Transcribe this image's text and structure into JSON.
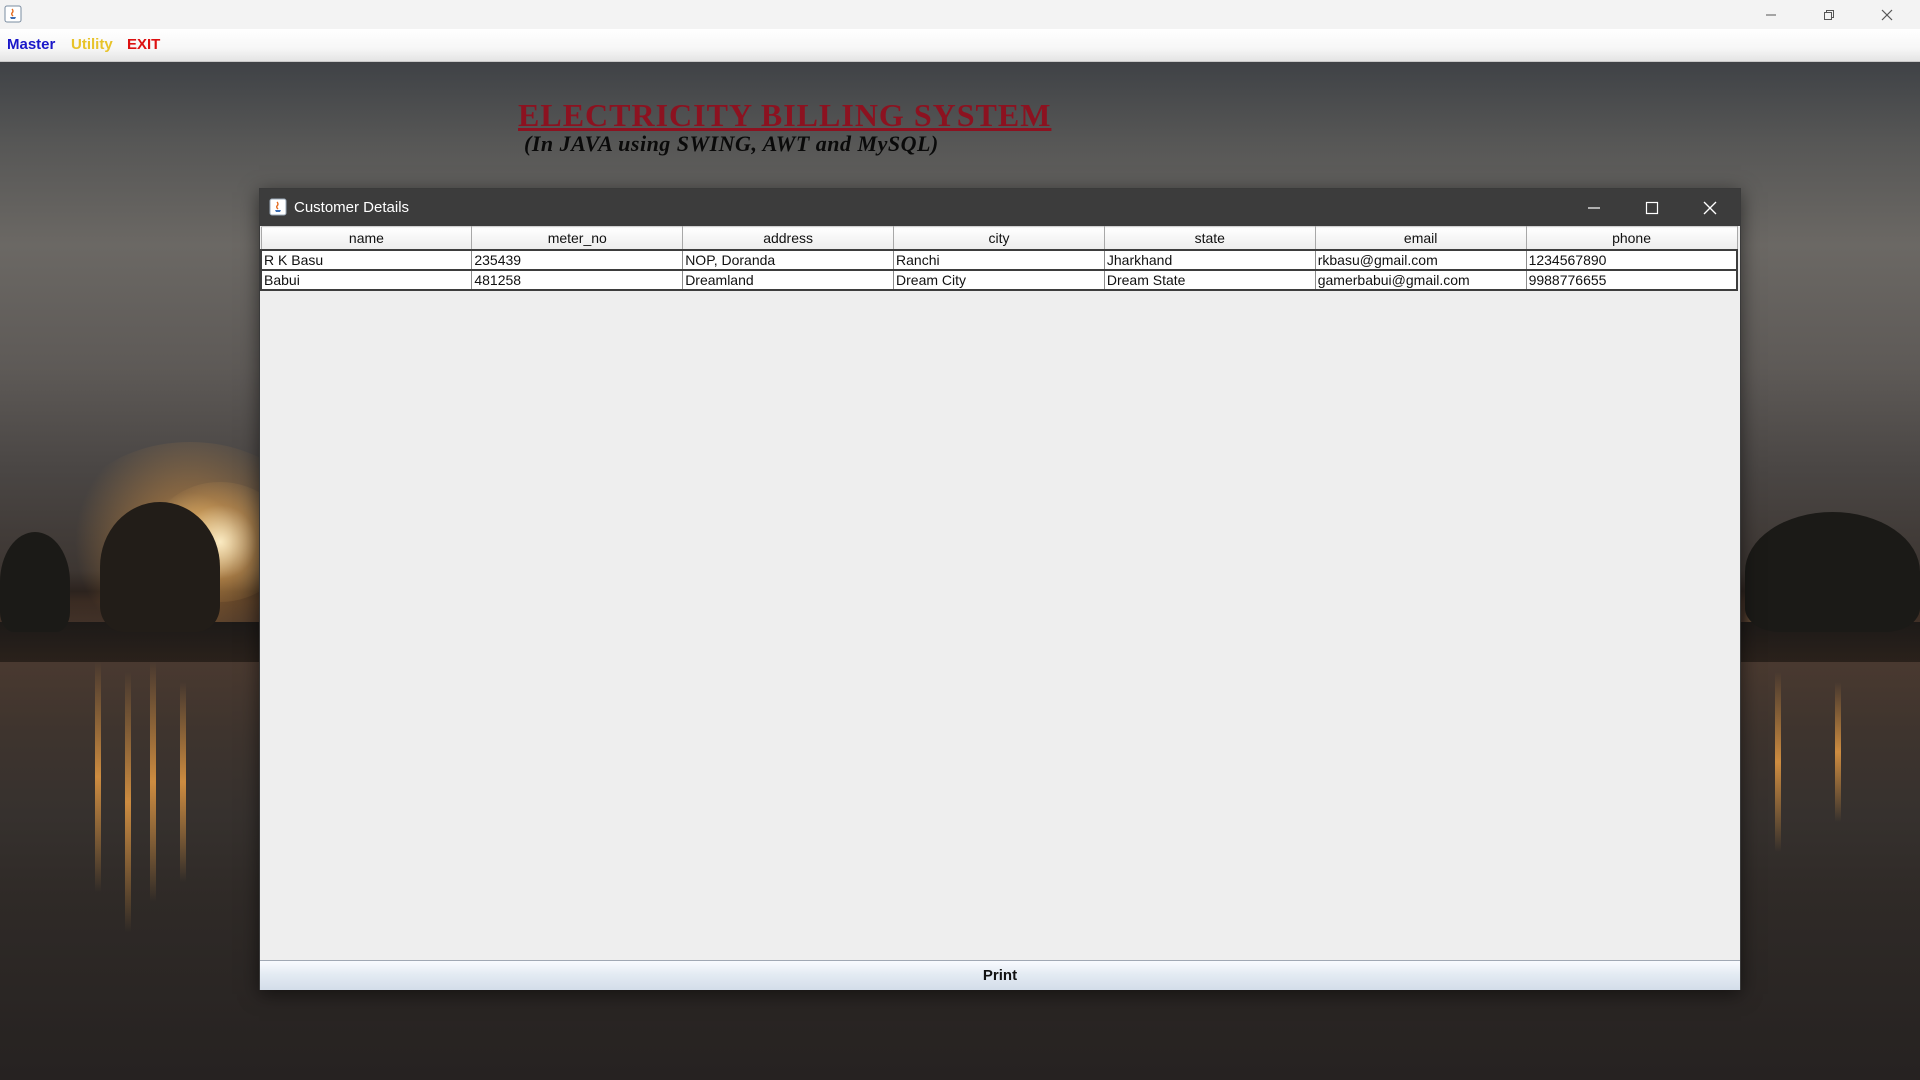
{
  "main_window": {
    "menu": [
      {
        "label": "Master",
        "color": "#1a17c9"
      },
      {
        "label": "Utility",
        "color": "#e8c32a"
      },
      {
        "label": "EXIT",
        "color": "#dd1111"
      }
    ],
    "controls": [
      "minimize-icon",
      "restore-icon",
      "close-icon"
    ]
  },
  "banner": {
    "title": "ELECTRICITY BILLING SYSTEM",
    "subtitle": "(In JAVA using SWING, AWT and MySQL)",
    "title_color": "#8c1220"
  },
  "customer_frame": {
    "title": "Customer Details",
    "controls": [
      "minimize-icon",
      "maximize-icon",
      "close-icon"
    ],
    "table": {
      "columns": [
        "name",
        "meter_no",
        "address",
        "city",
        "state",
        "email",
        "phone"
      ],
      "rows": [
        [
          "R K Basu",
          "235439",
          "NOP, Doranda",
          "Ranchi",
          "Jharkhand",
          "rkbasu@gmail.com",
          "1234567890"
        ],
        [
          "Babui",
          "481258",
          "Dreamland",
          "Dream City",
          "Dream State",
          "gamerbabui@gmail.com",
          "9988776655"
        ]
      ]
    },
    "print_label": "Print"
  }
}
